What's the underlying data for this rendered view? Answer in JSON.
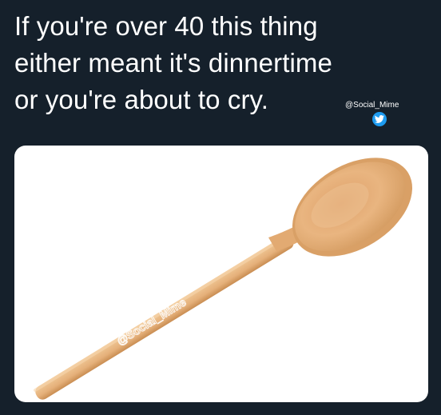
{
  "caption": {
    "lines": [
      "If you're over 40 this thing",
      "either meant it's dinnertime",
      "or you're about to cry."
    ]
  },
  "watermark": {
    "handle": "@Social_Mime",
    "image_overlay": "@Social_Mime",
    "icon": "twitter-bird-icon"
  },
  "image": {
    "subject": "wooden-spoon-icon"
  },
  "colors": {
    "background": "#15202b",
    "text": "#ffffff",
    "twitter_blue": "#1d9bf0",
    "wood": "#e6b07a",
    "wood_dark": "#c98d52"
  }
}
